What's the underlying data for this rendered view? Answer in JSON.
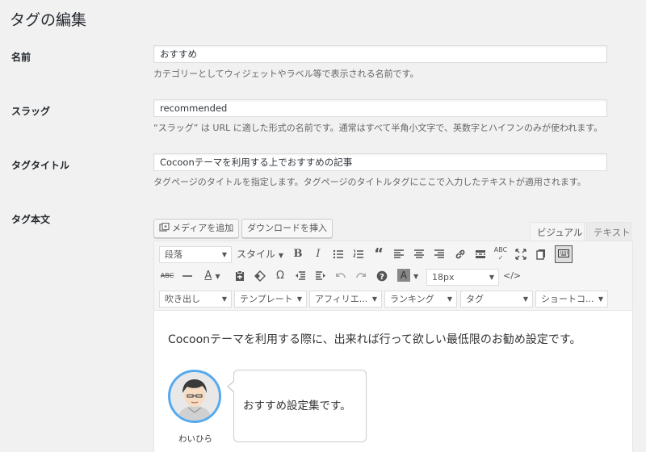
{
  "page": {
    "title": "タグの編集"
  },
  "fields": {
    "name": {
      "label": "名前",
      "value": "おすすめ",
      "description": "カテゴリーとしてウィジェットやラベル等で表示される名前です。"
    },
    "slug": {
      "label": "スラッグ",
      "value": "recommended",
      "description": "“スラッグ” は URL に適した形式の名前です。通常はすべて半角小文字で、英数字とハイフンのみが使われます。"
    },
    "tag_title": {
      "label": "タグタイトル",
      "value": "Cocoonテーマを利用する上でおすすめの記事",
      "description": "タグページのタイトルを指定します。タグページのタイトルタグにここで入力したテキストが適用されます。"
    },
    "tag_body": {
      "label": "タグ本文"
    }
  },
  "editor": {
    "add_media_label": "メディアを追加",
    "download_insert_label": "ダウンロードを挿入",
    "tabs": {
      "visual": "ビジュアル",
      "text": "テキスト"
    },
    "toolbar": {
      "format_select": "段落",
      "style_select": "スタイル",
      "font_size_select": "18px",
      "row3_selects": [
        "吹き出し",
        "テンプレート",
        "アフィリエ...",
        "ランキング",
        "タグ",
        "ショートコ..."
      ]
    },
    "content": {
      "paragraph": "Cocoonテーマを利用する際に、出来れば行って欲しい最低限のお勧め設定です。",
      "speech_bubble": {
        "text": "おすすめ設定集です。",
        "speaker_name": "わいひら"
      }
    }
  }
}
